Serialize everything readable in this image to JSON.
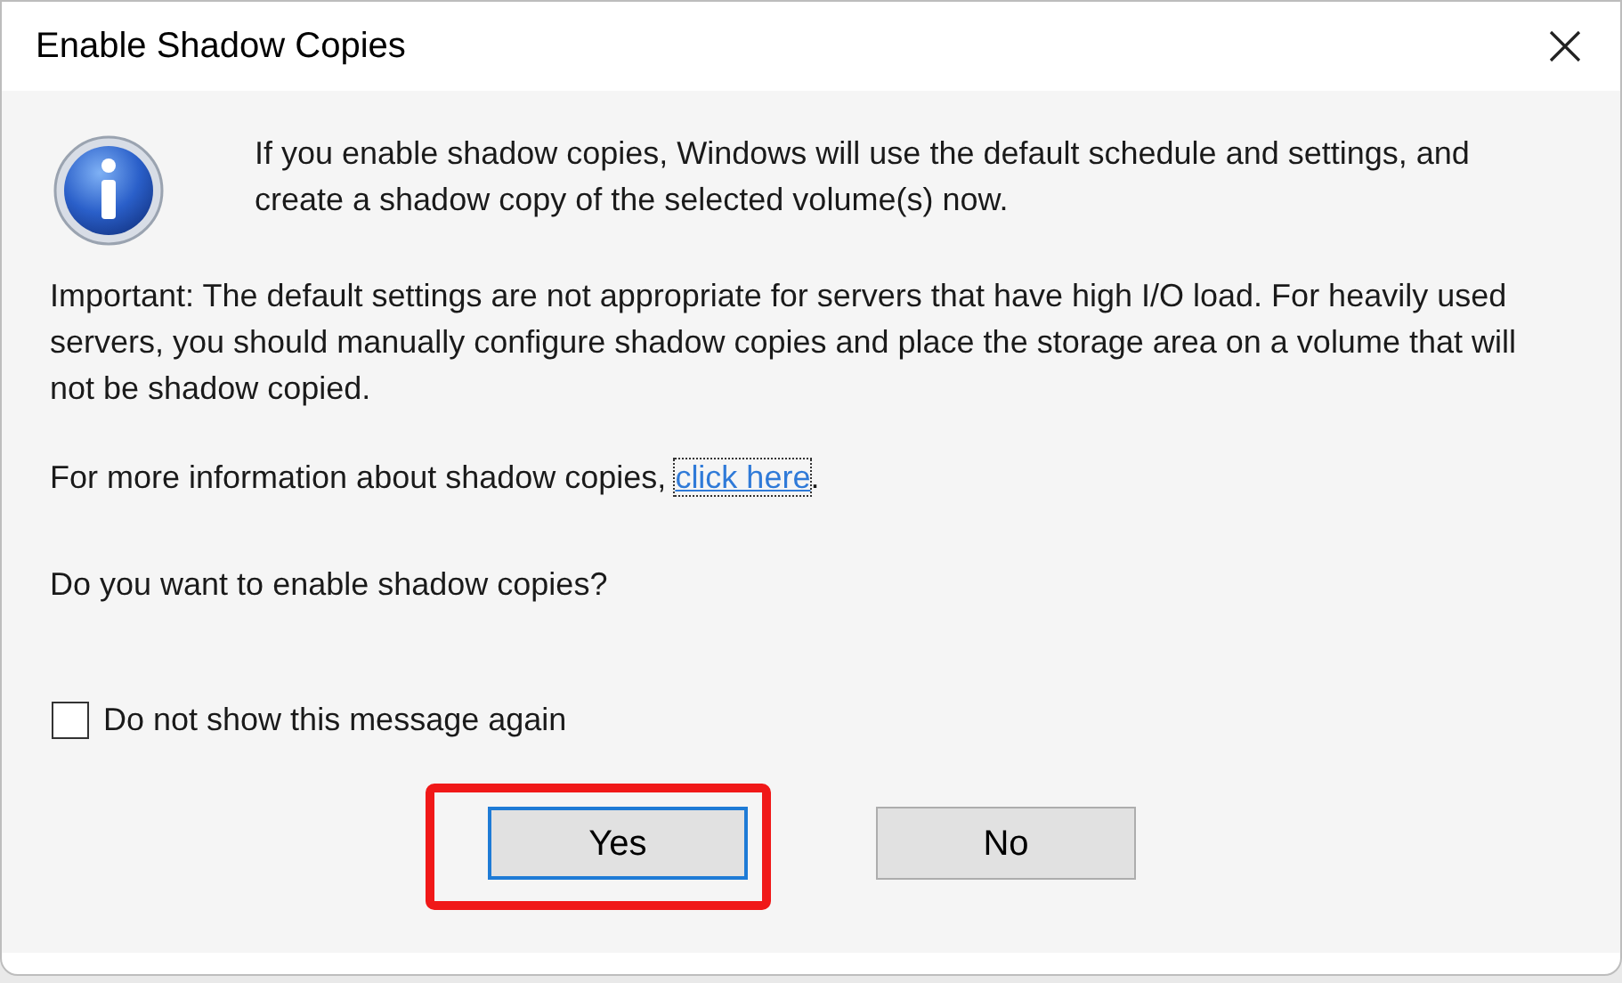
{
  "window": {
    "title": "Enable Shadow Copies"
  },
  "message": "If you enable shadow copies, Windows will use the default schedule and settings, and create a shadow copy of the selected volume(s) now.",
  "important": "Important: The default settings are not appropriate for servers that have high I/O load. For heavily used servers, you should manually configure shadow copies and place the storage area on a volume that will not be shadow copied.",
  "info": {
    "text": "For more information about shadow copies, ",
    "link": "click here",
    "after": "."
  },
  "question": "Do you want to enable shadow copies?",
  "checkbox": {
    "label": "Do not show this message again",
    "checked": false
  },
  "buttons": [
    {
      "label": "Yes",
      "default": true,
      "highlighted": true
    },
    {
      "label": "No",
      "default": false,
      "highlighted": false
    }
  ]
}
